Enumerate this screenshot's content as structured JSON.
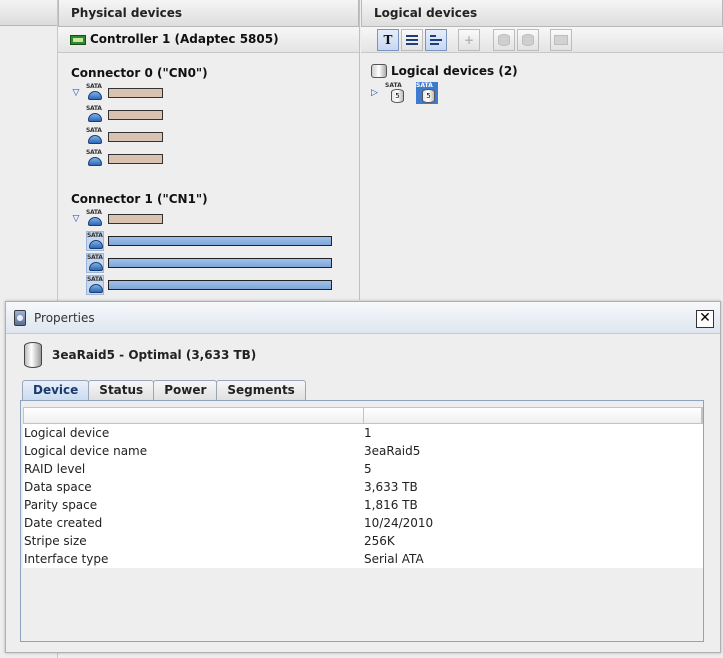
{
  "physical": {
    "header": "Physical devices",
    "controller": "Controller 1 (Adaptec 5805)",
    "connectors": [
      {
        "title": "Connector 0 (\"CN0\")"
      },
      {
        "title": "Connector 1 (\"CN1\")"
      }
    ],
    "disk_icon_label": "SATA"
  },
  "logical": {
    "header": "Logical devices",
    "title": "Logical devices (2)",
    "items": [
      {
        "badge": "SATA",
        "level": "5"
      },
      {
        "badge": "SATA",
        "level": "5"
      }
    ]
  },
  "toolbar": {
    "text_view": "T"
  },
  "dialog": {
    "title": "Properties",
    "close": "✕",
    "heading": "3eaRaid5 - Optimal (3,633 TB)",
    "tabs": [
      "Device",
      "Status",
      "Power",
      "Segments"
    ],
    "rows": [
      {
        "label": "Logical device",
        "value": "1"
      },
      {
        "label": "Logical device name",
        "value": "3eaRaid5"
      },
      {
        "label": "RAID level",
        "value": "5"
      },
      {
        "label": "Data space",
        "value": "3,633 TB"
      },
      {
        "label": "Parity space",
        "value": "1,816 TB"
      },
      {
        "label": "Date created",
        "value": "10/24/2010"
      },
      {
        "label": "Stripe size",
        "value": "256K"
      },
      {
        "label": "Interface type",
        "value": "Serial ATA"
      }
    ]
  },
  "colors": {
    "free_segment": "#d9c2b0",
    "used_segment": "#8fb3e0",
    "selection": "#3e7bd0"
  }
}
